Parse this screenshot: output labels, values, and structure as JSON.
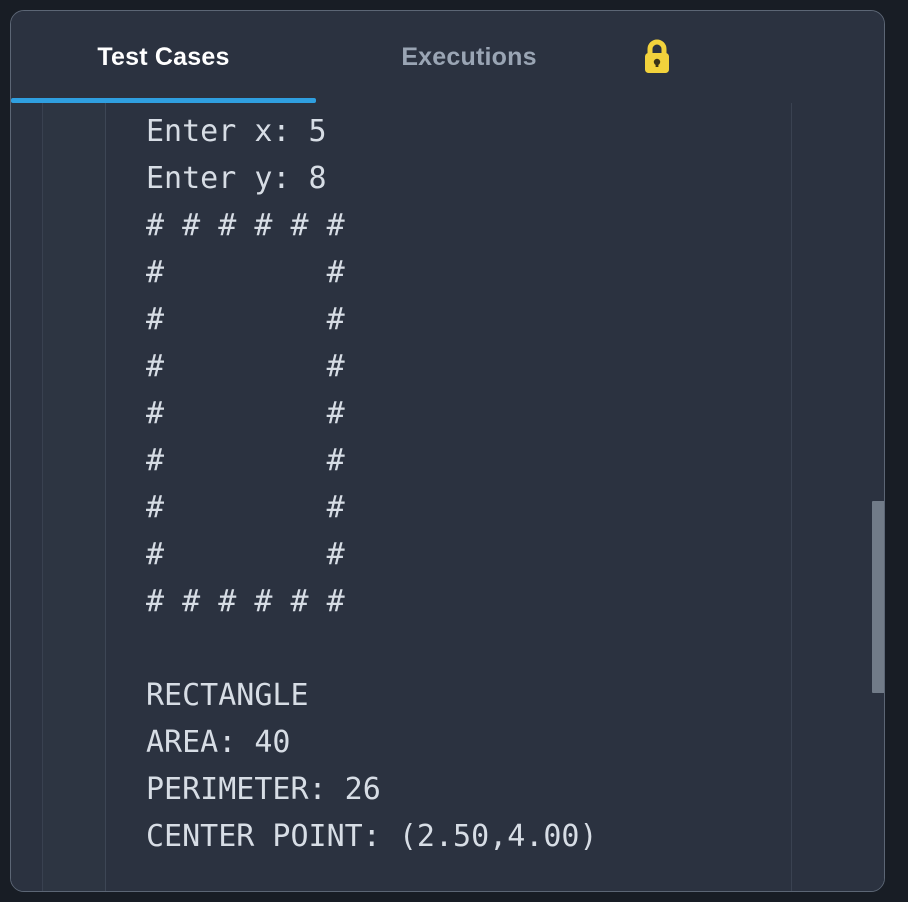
{
  "panel": {
    "accent_color": "#2f9fe0",
    "background_color": "#2b3240",
    "border_color": "#5c6675",
    "console_text_color": "#d7dde5"
  },
  "tabs": [
    {
      "label": "Test Cases",
      "active": true
    },
    {
      "label": "Executions",
      "active": false
    }
  ],
  "lock": {
    "icon": "lock-closed-icon",
    "color": "#f2d23c",
    "title": "Locked"
  },
  "console": {
    "lines": [
      "Enter x: 5",
      "Enter y: 8",
      "# # # # # #",
      "#         #",
      "#         #",
      "#         #",
      "#         #",
      "#         #",
      "#         #",
      "#         #",
      "# # # # # #",
      "",
      "RECTANGLE",
      "AREA: 40",
      "PERIMETER: 26",
      "CENTER POINT: (2.50,4.00)"
    ],
    "values": {
      "input_x": "5",
      "input_y": "8",
      "shape": "RECTANGLE",
      "area": "40",
      "perimeter": "26",
      "center_point": "(2.50,4.00)"
    }
  },
  "scrollbar": {
    "orientation": "vertical",
    "thumb_color": "#717b88"
  }
}
